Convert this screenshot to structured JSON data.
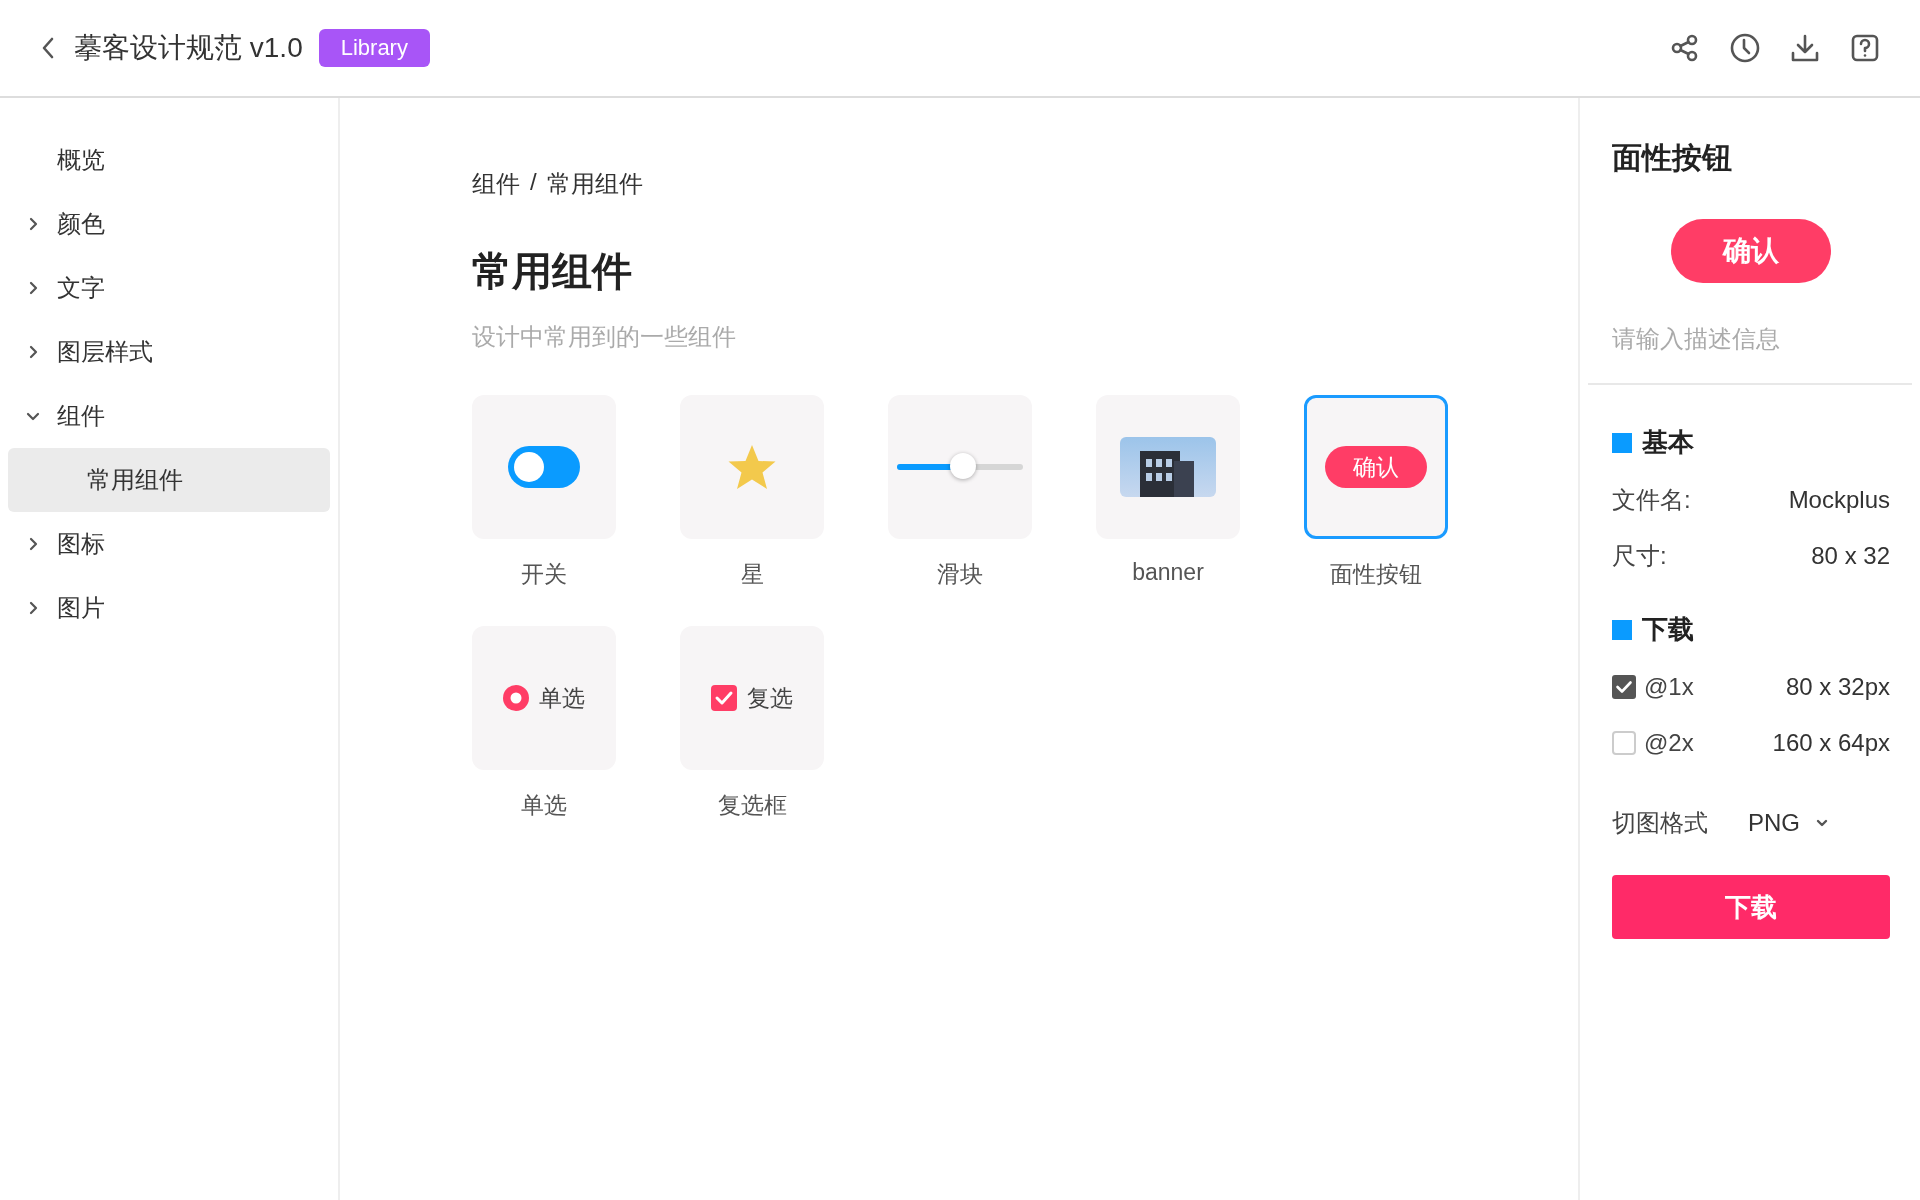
{
  "header": {
    "title": "摹客设计规范 v1.0",
    "badge": "Library"
  },
  "sidebar": {
    "items": [
      {
        "label": "概览",
        "kind": "page"
      },
      {
        "label": "颜色",
        "kind": "group",
        "expanded": false
      },
      {
        "label": "文字",
        "kind": "group",
        "expanded": false
      },
      {
        "label": "图层样式",
        "kind": "group",
        "expanded": false
      },
      {
        "label": "组件",
        "kind": "group",
        "expanded": true,
        "children": [
          {
            "label": "常用组件",
            "selected": true
          }
        ]
      },
      {
        "label": "图标",
        "kind": "group",
        "expanded": false
      },
      {
        "label": "图片",
        "kind": "group",
        "expanded": false
      }
    ]
  },
  "main": {
    "breadcrumb": {
      "items": [
        "组件",
        "常用组件"
      ],
      "separator": "/"
    },
    "title": "常用组件",
    "subtitle": "设计中常用到的一些组件",
    "cards": [
      {
        "label": "开关",
        "kind": "toggle",
        "on": true,
        "selected": false
      },
      {
        "label": "星",
        "kind": "star",
        "selected": false
      },
      {
        "label": "滑块",
        "kind": "slider",
        "level": 0.52,
        "selected": false
      },
      {
        "label": "banner",
        "kind": "image",
        "selected": false
      },
      {
        "label": "面性按钮",
        "kind": "button",
        "text": "确认",
        "selected": true
      },
      {
        "label": "单选",
        "kind": "radio",
        "text": "单选",
        "checked": true,
        "selected": false
      },
      {
        "label": "复选框",
        "kind": "checkbox",
        "text": "复选",
        "checked": true,
        "selected": false
      }
    ]
  },
  "detail": {
    "title": "面性按钮",
    "preview_button": "确认",
    "description": {
      "placeholder": "请输入描述信息"
    },
    "basic": {
      "heading": "基本",
      "rows": [
        {
          "label": "文件名:",
          "value": "Mockplus"
        },
        {
          "label": "尺寸:",
          "value": "80 x 32"
        }
      ]
    },
    "download": {
      "heading": "下载",
      "options": [
        {
          "label": "@1x",
          "size": "80 x 32px",
          "checked": true
        },
        {
          "label": "@2x",
          "size": "160 x 64px",
          "checked": false
        }
      ],
      "format_label": "切图格式",
      "format_value": "PNG",
      "button": "下载"
    }
  }
}
